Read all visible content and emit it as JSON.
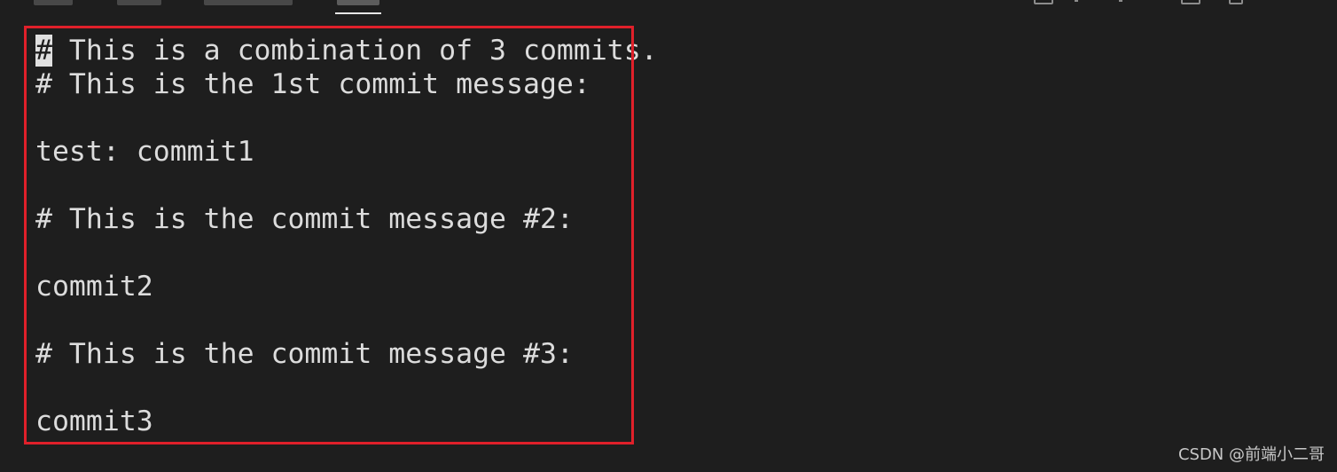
{
  "editor": {
    "cursor_char": "#",
    "first_line_rest": " This is a combination of 3 commits.",
    "lines": [
      "# This is the 1st commit message:",
      "",
      "test: commit1",
      "",
      "# This is the commit message #2:",
      "",
      "commit2",
      "",
      "# This is the commit message #3:",
      "",
      "commit3"
    ]
  },
  "watermark": "CSDN @前端小二哥",
  "colors": {
    "background": "#1e1e1e",
    "text": "#dcdcdc",
    "highlight_box": "#e0202a",
    "cursor": "#e0e0e0"
  }
}
